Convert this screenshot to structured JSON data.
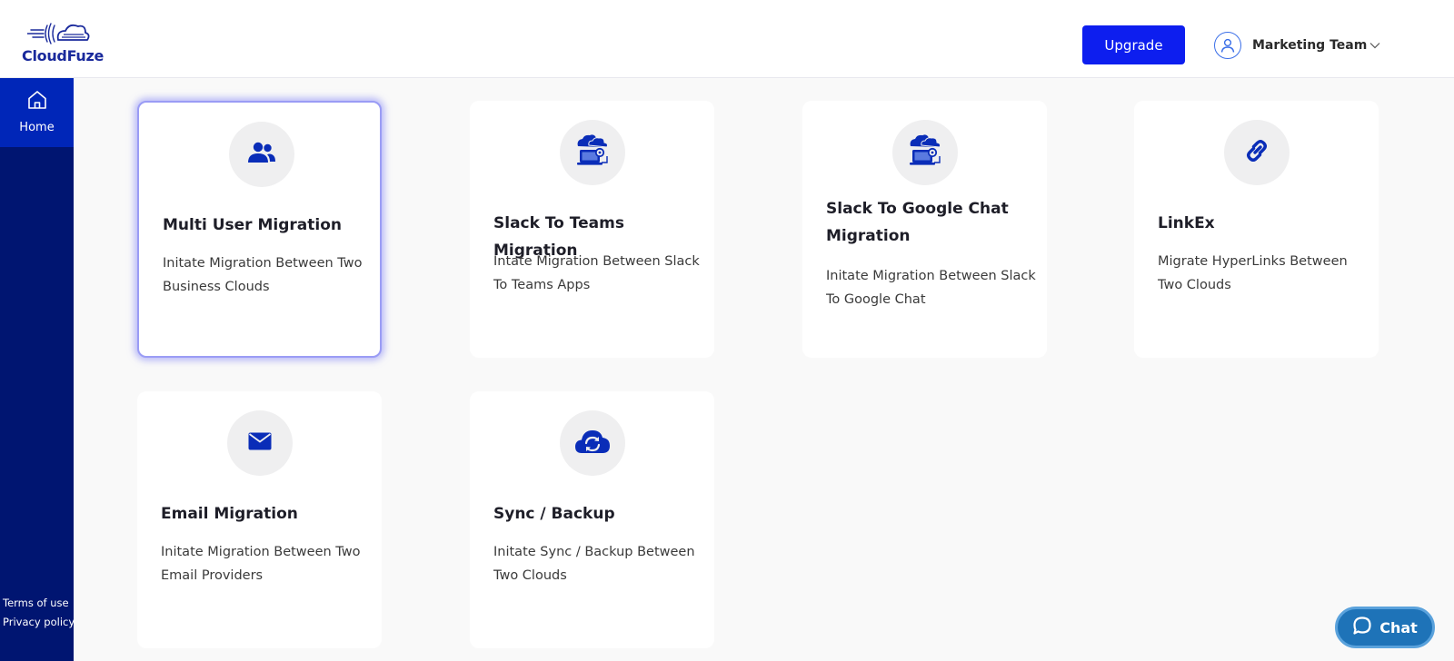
{
  "header": {
    "logo_text": "CloudFuze",
    "upgrade_label": "Upgrade",
    "user_name": "Marketing Team"
  },
  "sidebar": {
    "home_label": "Home",
    "terms_label": "Terms of use",
    "privacy_label": "Privacy policy"
  },
  "cards": [
    {
      "icon": "users-icon",
      "title": "Multi User Migration",
      "description": "Initate Migration Between Two Business Clouds",
      "selected": true
    },
    {
      "icon": "cloud-laptop-icon",
      "title": "Slack To Teams Migration",
      "description": "Intate Migration Between Slack To Teams Apps",
      "selected": false
    },
    {
      "icon": "cloud-laptop-icon",
      "title": "Slack To Google Chat Migration",
      "description": "Initate Migration Between Slack To Google Chat",
      "selected": false
    },
    {
      "icon": "link-icon",
      "title": "LinkEx",
      "description": "Migrate HyperLinks Between Two Clouds",
      "selected": false
    },
    {
      "icon": "envelope-icon",
      "title": "Email Migration",
      "description": "Initate Migration Between Two Email Providers",
      "selected": false
    },
    {
      "icon": "cloud-sync-icon",
      "title": "Sync / Backup",
      "description": "Initate Sync / Backup Between Two Clouds",
      "selected": false
    }
  ],
  "chat": {
    "label": "Chat"
  },
  "colors": {
    "accent": "#0d1eef",
    "sidebar": "#001571",
    "sidebar_active": "#0026b8",
    "icon": "#0a2db8",
    "chat": "#1e73b8"
  }
}
